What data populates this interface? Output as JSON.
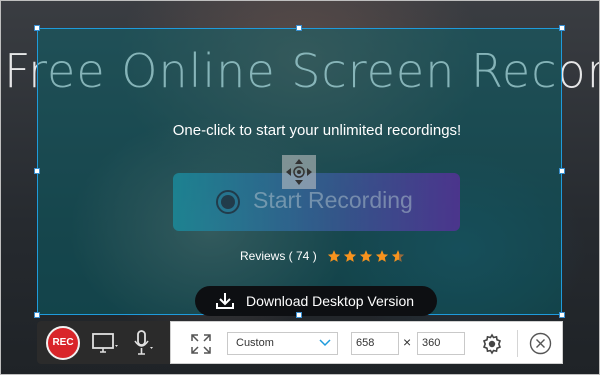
{
  "hero": {
    "title": "Free Online Screen Recorder",
    "subtitle": "One-click to start your unlimited recordings!",
    "start_label": "Start Recording",
    "reviews_label": "Reviews ( 74 )",
    "rating": 4.5,
    "download_label": "Download Desktop Version"
  },
  "toolbar": {
    "rec_label": "REC",
    "region_select": "Custom",
    "width": "658",
    "height": "360",
    "times_symbol": "×"
  },
  "icons": {
    "record": "rec-icon",
    "screen": "monitor-icon",
    "mic": "microphone-icon",
    "fullscreen": "expand-icon",
    "settings": "gear-icon",
    "close": "close-icon",
    "move": "move-arrows-icon",
    "download": "download-icon"
  },
  "colors": {
    "selection_border": "#1e9bdc",
    "rec": "#d9252a",
    "star": "#f7931e"
  }
}
